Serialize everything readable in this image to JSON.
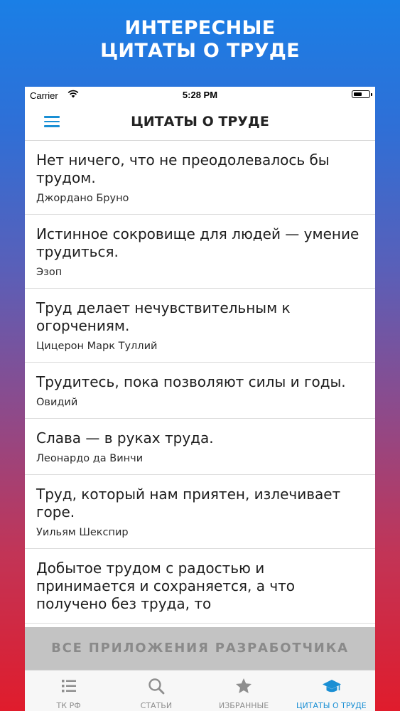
{
  "promo": {
    "title_line1": "ИНТЕРЕСНЫЕ",
    "title_line2": "ЦИТАТЫ О ТРУДЕ"
  },
  "status": {
    "carrier": "Carrier",
    "time": "5:28 PM"
  },
  "navbar": {
    "title": "ЦИТАТЫ О ТРУДЕ"
  },
  "quotes": [
    {
      "text": "Нет ничего, что не преодолевалось бы трудом.",
      "author": "Джордано Бруно"
    },
    {
      "text": "Истинное сокровище для людей — умение трудиться.",
      "author": "Эзоп"
    },
    {
      "text": "Труд делает нечувствительным к огорчениям.",
      "author": "Цицерон Марк Туллий"
    },
    {
      "text": "Трудитесь, пока позволяют силы и годы.",
      "author": "Овидий"
    },
    {
      "text": "Слава — в руках труда.",
      "author": "Леонардо да Винчи"
    },
    {
      "text": "Труд, который нам приятен, излечивает горе.",
      "author": "Уильям Шекспир"
    },
    {
      "text": "Добытое трудом с радостью и принимается и сохраняется, а что получено без труда, то",
      "author": ""
    }
  ],
  "cta": {
    "label": "ВСЕ ПРИЛОЖЕНИЯ РАЗРАБОТЧИКА"
  },
  "tabs": [
    {
      "label": "ТК РФ",
      "icon": "list-icon",
      "active": false
    },
    {
      "label": "СТАТЬИ",
      "icon": "search-icon",
      "active": false
    },
    {
      "label": "ИЗБРАННЫЕ",
      "icon": "star-icon",
      "active": false
    },
    {
      "label": "ЦИТАТЫ О ТРУДЕ",
      "icon": "graduation-cap-icon",
      "active": true
    }
  ],
  "colors": {
    "accent": "#1a8fd4",
    "inactive": "#8e8e8e",
    "gradient_top": "#1a7fe6",
    "gradient_bottom": "#e01c2c"
  }
}
